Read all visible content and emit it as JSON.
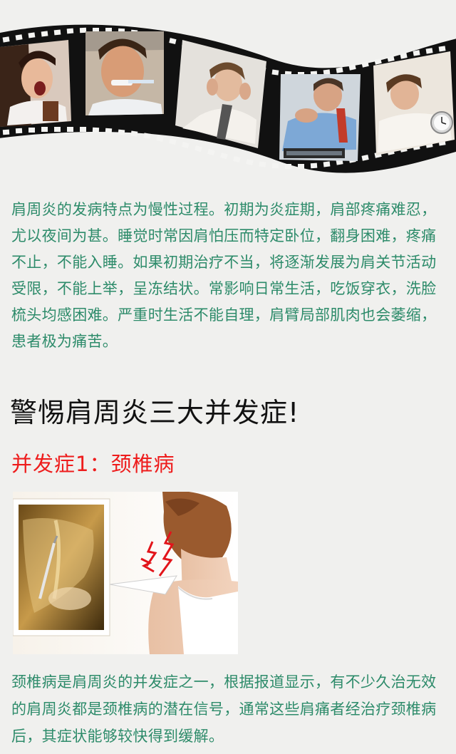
{
  "intro": {
    "text": "肩周炎的发病特点为慢性过程。初期为炎症期，肩部疼痛难忍，尤以夜间为甚。睡觉时常因肩怕压而特定卧位，翻身困难，疼痛不止，不能入睡。如果初期治疗不当，将逐渐发展为肩关节活动受限，不能上举，呈冻结状。常影响日常生活，吃饭穿衣，洗脸梳头均感困难。严重时生活不能自理，肩臂局部肌肉也会萎缩，患者极为痛苦。"
  },
  "headline": "警惕肩周炎三大并发症!",
  "complication1": {
    "title": "并发症1：颈椎病",
    "body": "颈椎病是肩周炎的并发症之一，根据报道显示，有不少久治无效的肩周炎都是颈椎病的潜在信号，通常这些肩痛者经治疗颈椎病后，其症状能够较快得到缓解。"
  },
  "colors": {
    "body_text": "#2d8b6a",
    "accent_red": "#ee1c1c",
    "film": "#111111"
  }
}
